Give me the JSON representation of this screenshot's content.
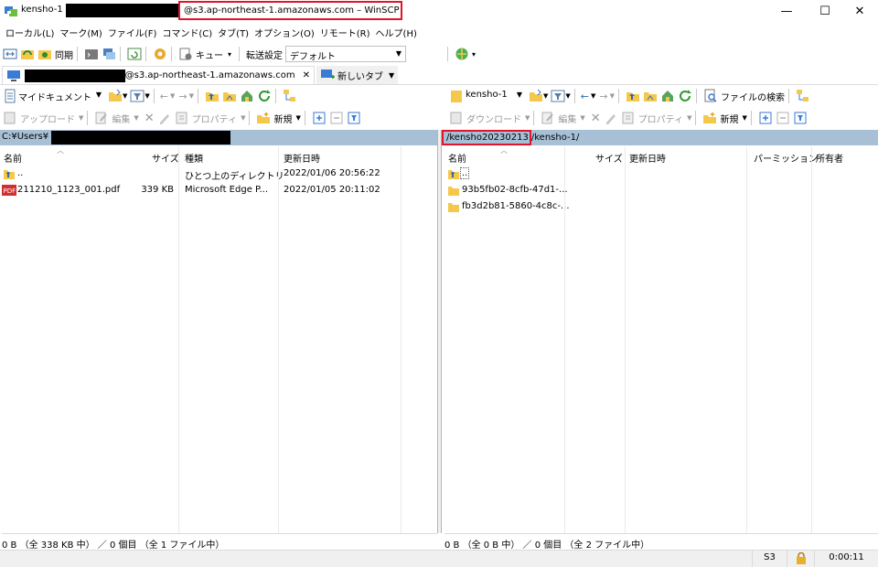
{
  "window": {
    "title_prefix": "kensho-1 –",
    "title_suffix": "@s3.ap-northeast-1.amazonaws.com – WinSCP",
    "minimize": "—",
    "maximize": "☐",
    "close": "✕"
  },
  "menu": [
    "ローカル(L)",
    "マーク(M)",
    "ファイル(F)",
    "コマンド(C)",
    "タブ(T)",
    "オプション(O)",
    "リモート(R)",
    "ヘルプ(H)"
  ],
  "toolbar": {
    "sync_label": "同期",
    "queue_label": "キュー",
    "transfer_label": "転送設定",
    "transfer_value": "デフォルト"
  },
  "tabs": {
    "session_label": "@s3.ap-northeast-1.amazonaws.com",
    "session_close": "✕",
    "new_tab_label": "新しいタブ"
  },
  "left": {
    "location": "マイドキュメント",
    "upload_label": "アップロード",
    "edit_label": "編集",
    "properties_label": "プロパティ",
    "new_label": "新規",
    "path": "C:¥Users¥",
    "columns": {
      "name": "名前",
      "size": "サイズ",
      "type": "種類",
      "modified": "更新日時"
    },
    "rows": [
      {
        "name": "..",
        "size": "",
        "type": "ひとつ上のディレクトリ",
        "modified": "2022/01/06 20:56:22"
      },
      {
        "name": "211210_1123_001.pdf",
        "size": "339 KB",
        "type": "Microsoft Edge P...",
        "modified": "2022/01/05 20:11:02"
      }
    ],
    "status": "0 B （全 338 KB 中） ／ 0 個目 （全 1 ファイル中）"
  },
  "right": {
    "location": "kensho-1",
    "download_label": "ダウンロード",
    "edit_label": "編集",
    "properties_label": "プロパティ",
    "new_label": "新規",
    "find_label": "ファイルの検索",
    "path_highlight": "/kensho20230213",
    "path_rest": "/kensho-1/",
    "columns": {
      "name": "名前",
      "size": "サイズ",
      "modified": "更新日時",
      "permission": "パーミッション",
      "owner": "所有者"
    },
    "rows": [
      {
        "name": ".."
      },
      {
        "name": "93b5fb02-8cfb-47d1-..."
      },
      {
        "name": "fb3d2b81-5860-4c8c-..."
      }
    ],
    "status": "0 B （全 0 B 中） ／ 0 個目 （全 2 ファイル中）"
  },
  "statusbar": {
    "protocol": "S3",
    "elapsed": "0:00:11"
  },
  "colors": {
    "highlight": "#e0142b",
    "pathbar": "#a8c0d6",
    "folder": "#f5c84c"
  }
}
